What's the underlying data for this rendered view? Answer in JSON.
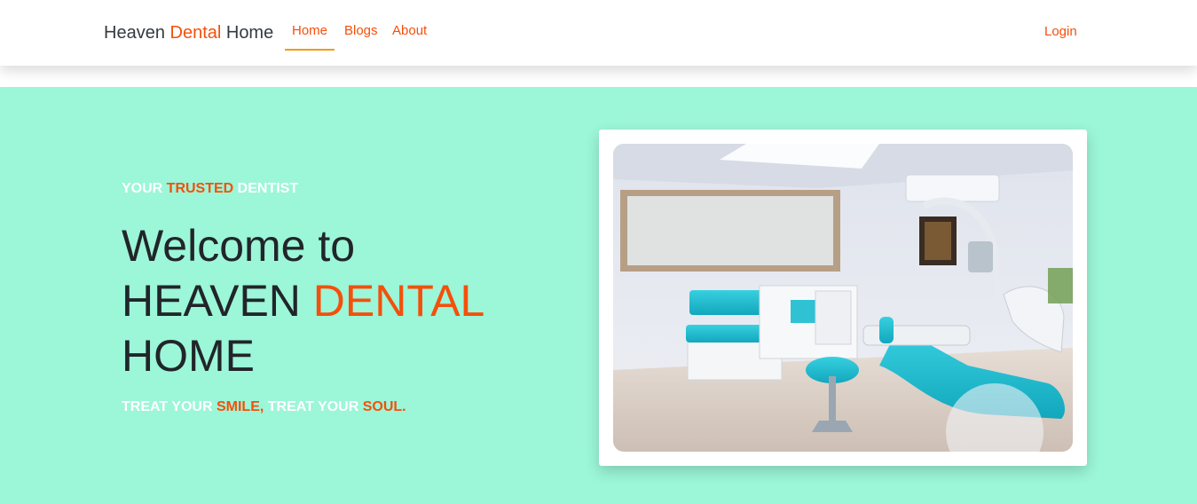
{
  "navbar": {
    "brand": {
      "part1": "Heaven ",
      "part2": "Dental",
      "part3": " Home"
    },
    "links": [
      {
        "label": "Home",
        "active": true
      },
      {
        "label": "Blogs",
        "active": false
      },
      {
        "label": "About",
        "active": false
      }
    ],
    "login_label": "Login"
  },
  "hero": {
    "tagline": {
      "part1": "YOUR ",
      "part2": "TRUSTED",
      "part3": " DENTIST"
    },
    "headline": {
      "line1": "Welcome to",
      "line2a": "HEAVEN ",
      "line2b": "DENTAL",
      "line3": "HOME"
    },
    "subline": {
      "part1": "TREAT YOUR ",
      "part2": "SMILE,",
      "part3": " TREAT YOUR ",
      "part4": "SOUL."
    },
    "image_icon": "dental-clinic-photo"
  },
  "colors": {
    "accent": "#f4500b",
    "hero_bg": "#9cf6d8",
    "active_underline": "#f39c12",
    "heading": "#212529"
  }
}
